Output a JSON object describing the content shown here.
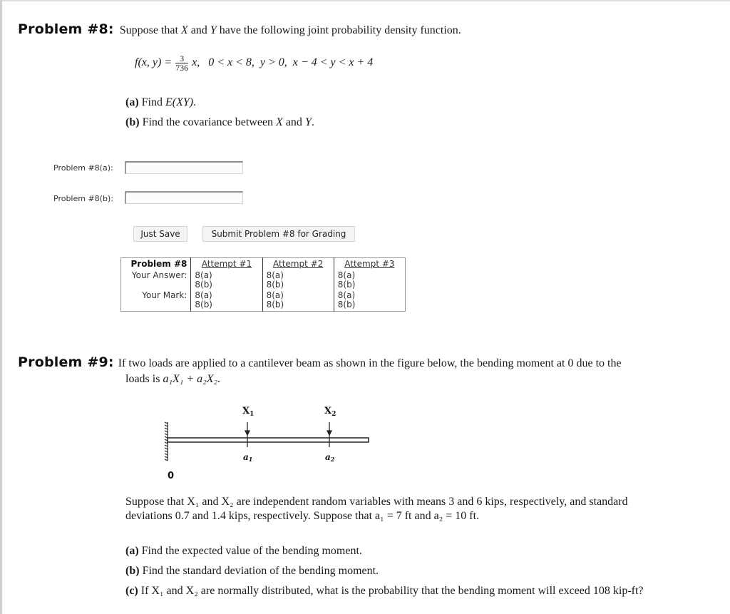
{
  "problem8": {
    "heading": "Problem #8:",
    "intro_pre": "Suppose that ",
    "var_x": "X",
    "intro_mid": " and ",
    "var_y": "Y",
    "intro_post": " have the following joint probability density function.",
    "formula": {
      "lhs": "f(x, y) = ",
      "frac_num": "3",
      "frac_den": "736",
      "rhs": "x,   0 < x < 8,  y > 0,  x − 4 < y < x + 4"
    },
    "parts": [
      {
        "label": "(a)",
        "text_pre": " Find ",
        "math": "E(XY)",
        "text_post": "."
      },
      {
        "label": "(b)",
        "text_pre": " Find the covariance between ",
        "math": "X",
        "text_mid": " and ",
        "math2": "Y",
        "text_post": "."
      }
    ],
    "answers": [
      {
        "label": "Problem #8(a):",
        "value": ""
      },
      {
        "label": "Problem #8(b):",
        "value": ""
      }
    ],
    "buttons": {
      "save": "Just Save",
      "submit": "Submit Problem #8 for Grading"
    },
    "attempts_table": {
      "header": "Problem #8",
      "attempts": [
        "Attempt #1",
        "Attempt #2",
        "Attempt #3"
      ],
      "row_answer_label": "Your Answer:",
      "row_mark_label": "Your Mark:",
      "cells": [
        {
          "answer_a": "8(a)",
          "answer_b": "8(b)",
          "mark_a": "8(a)",
          "mark_b": "8(b)"
        },
        {
          "answer_a": "8(a)",
          "answer_b": "8(b)",
          "mark_a": "8(a)",
          "mark_b": "8(b)"
        },
        {
          "answer_a": "8(a)",
          "answer_b": "8(b)",
          "mark_a": "8(a)",
          "mark_b": "8(b)"
        }
      ]
    }
  },
  "problem9": {
    "heading": "Problem #9:",
    "intro_line1": "If two loads are applied to a cantilever beam as shown in the figure below, the bending moment at 0 due to the",
    "intro_line2_pre": "loads is ",
    "intro_math": "a₁X₁ + a₂X₂",
    "intro_line2_post": ".",
    "figure": {
      "load1": "X",
      "load1_sub": "1",
      "load2": "X",
      "load2_sub": "2",
      "pos1": "a",
      "pos1_sub": "1",
      "pos2": "a",
      "pos2_sub": "2",
      "origin": "0"
    },
    "body_line1": "Suppose that X₁ and X₂ are independent random variables with means 3 and 6 kips, respectively, and standard",
    "body_line2": "deviations 0.7 and 1.4 kips, respectively. Suppose that a₁ = 7 ft and a₂ = 10 ft.",
    "parts": [
      {
        "label": "(a)",
        "text": " Find the expected value of the bending moment."
      },
      {
        "label": "(b)",
        "text": " Find the standard deviation of the bending moment."
      },
      {
        "label": "(c)",
        "text": " If X₁ and X₂ are normally distributed, what is the probability that the bending moment will exceed 108 kip-ft?"
      }
    ]
  }
}
